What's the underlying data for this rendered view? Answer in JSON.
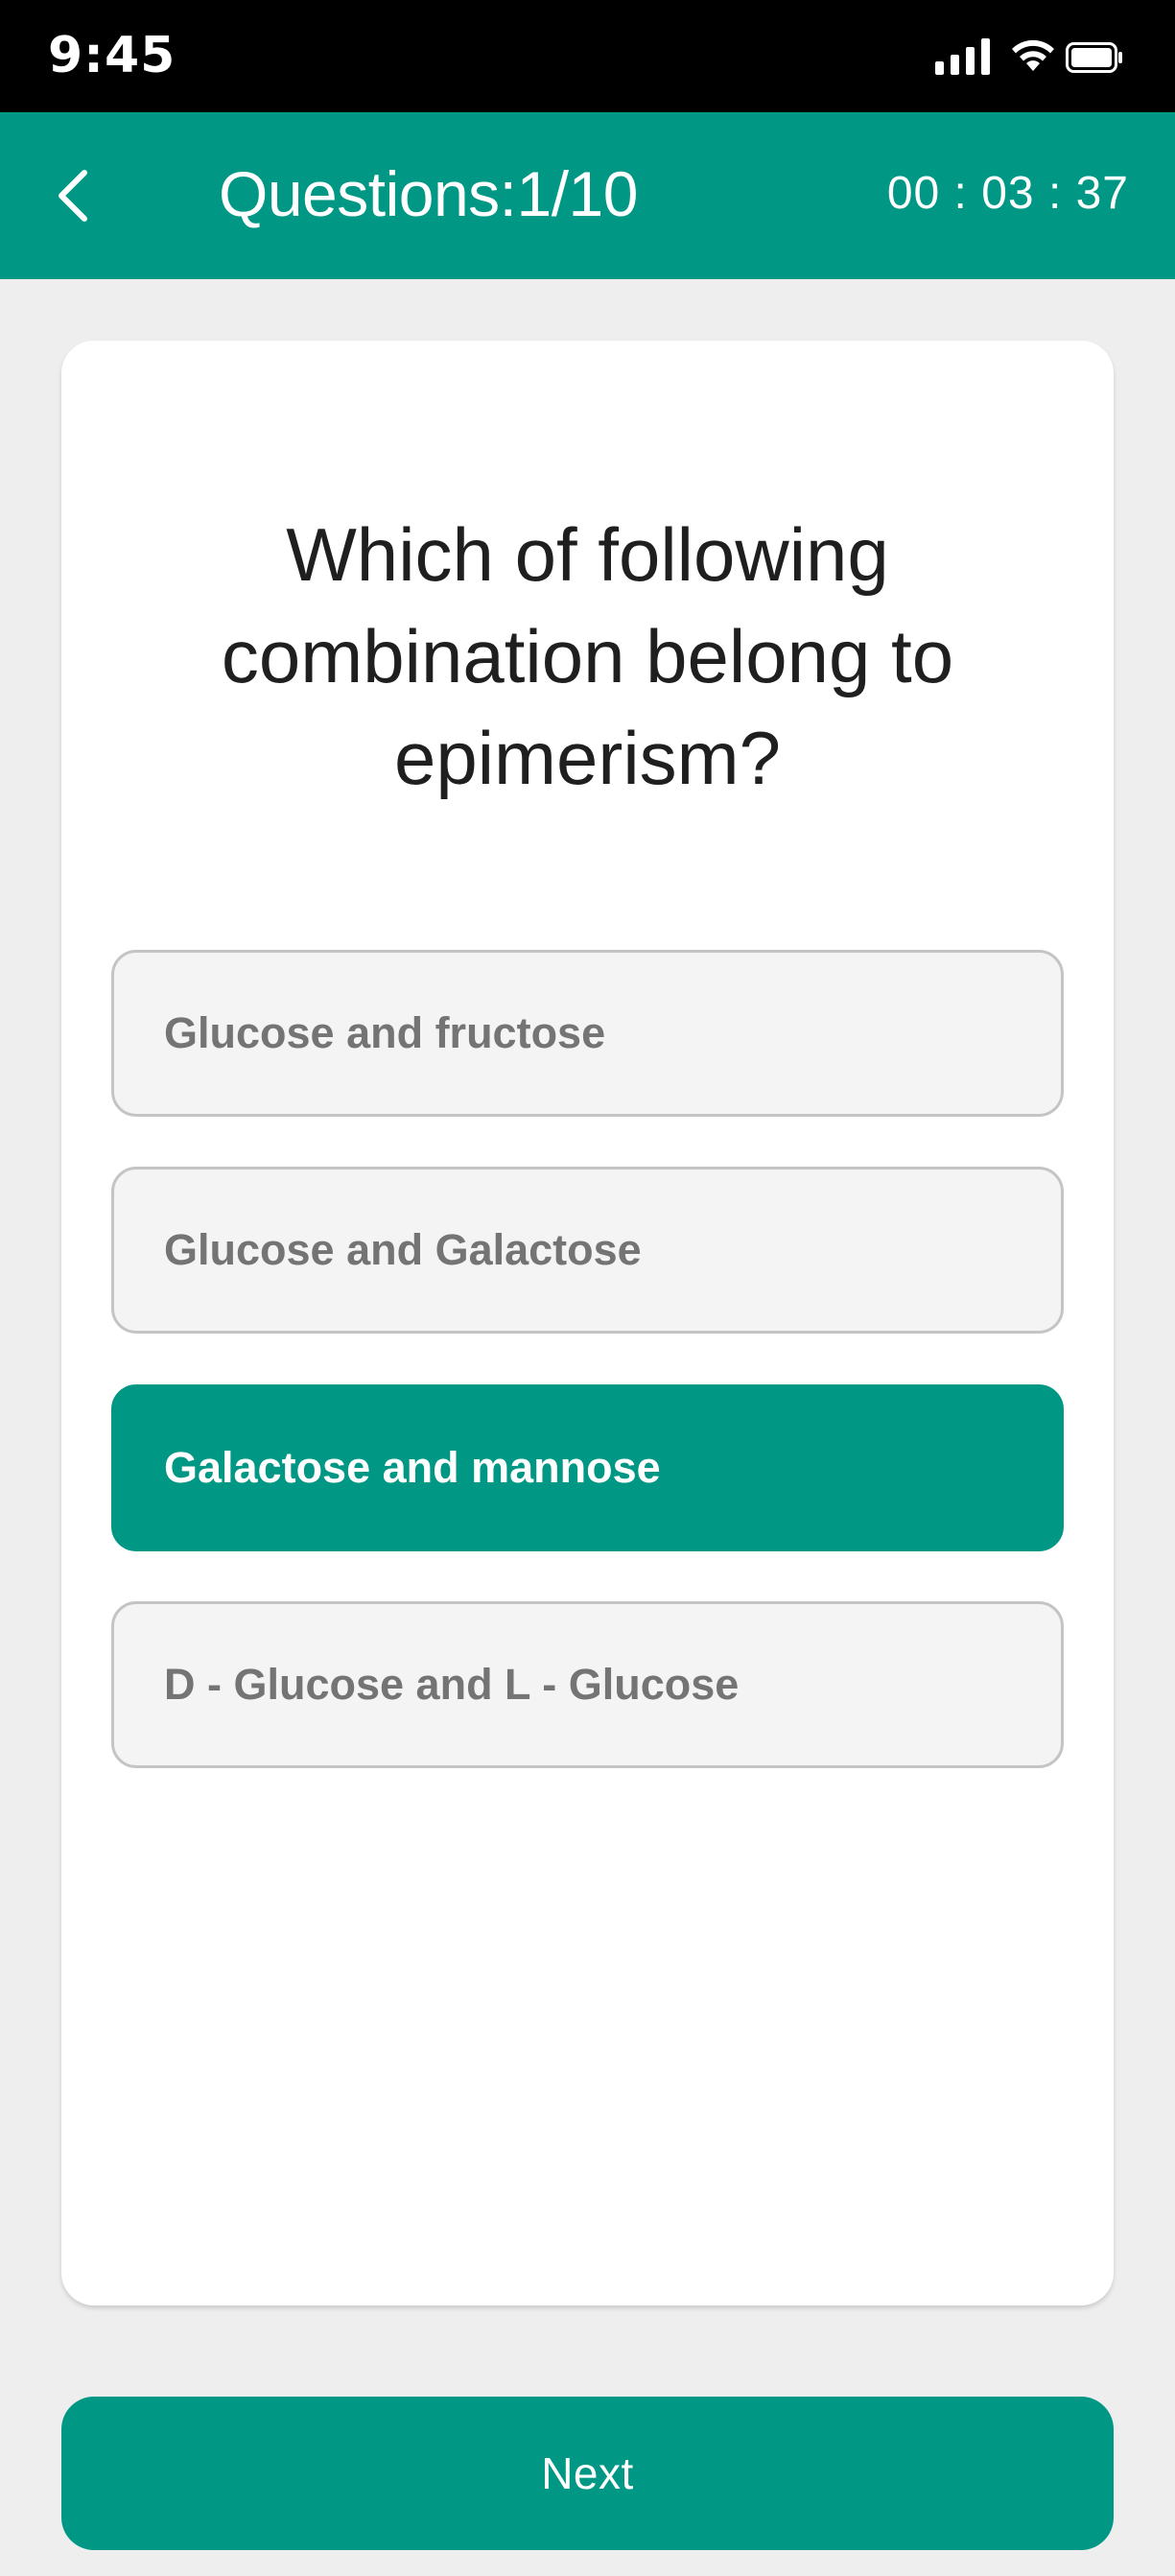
{
  "status_bar": {
    "time": "9:45",
    "icons": [
      "signal-icon",
      "wifi-icon",
      "battery-icon"
    ]
  },
  "header": {
    "back_icon": "chevron-left-icon",
    "title": "Questions:1/10",
    "timer": "00 : 03 : 37"
  },
  "question": {
    "text": "Which of following combination belong to epimerism?"
  },
  "options": [
    {
      "label": "Glucose and fructose",
      "selected": false
    },
    {
      "label": "Glucose and Galactose",
      "selected": false
    },
    {
      "label": "Galactose and mannose",
      "selected": true
    },
    {
      "label": "D - Glucose and L - Glucose",
      "selected": false
    }
  ],
  "footer": {
    "next_label": "Next"
  },
  "colors": {
    "accent": "#009885",
    "status_bar": "#000000",
    "background": "#eeeeee",
    "option_bg": "#f4f4f4",
    "option_border": "#c4c4c4",
    "option_text": "#747474",
    "question_text": "#1f1f1f"
  }
}
